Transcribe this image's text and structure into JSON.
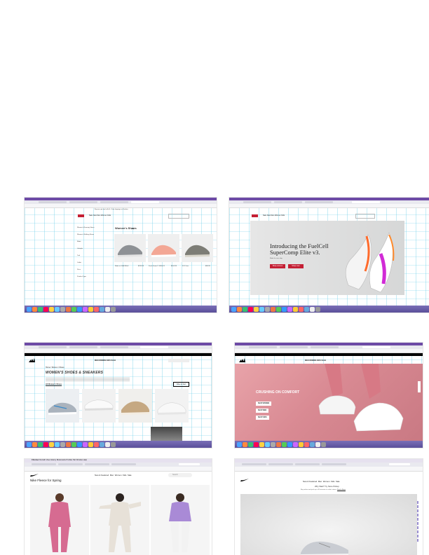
{
  "screens": {
    "nb_list": {
      "promo": "Buy one, get one half off + Free shipping on all orders",
      "title": "Women's Shoes",
      "count": "(73)",
      "sidebar": [
        "Women's Running Shoes",
        "Women's Walking Shoes",
        "Made",
        "Lifestyle",
        "Trail",
        "Outlet",
        "Price",
        "Product Type"
      ],
      "products": [
        {
          "name": "Made in USA 990v6",
          "price": "$199.99"
        },
        {
          "name": "Fresh Foam X 1080v13",
          "price": "$164.99"
        },
        {
          "name": "574 Core",
          "price": "$89.99"
        }
      ]
    },
    "nb_hero": {
      "headline_line1": "Introducing the FuelCell",
      "headline_line2": "SuperComp Elite v3.",
      "subtext": "Made for race day.",
      "button1": "Shop women",
      "button2": "Shop men"
    },
    "adidas_list": {
      "title": "WOMEN'S SHOES & SNEAKERS",
      "tab": "All Women's Shoes",
      "filter": "Filter & Sort",
      "breadcrumb": [
        "Home",
        "Women",
        "Shoes"
      ]
    },
    "adidas_hero": {
      "headline": "CRUSHING ON COMFORT",
      "buttons": [
        "SHOP WOMEN",
        "SHOP MEN",
        "SHOP KIDS"
      ]
    },
    "nike_list": {
      "title": "Nike Fleece for Spring",
      "menu": [
        "New & Featured",
        "Men",
        "Women",
        "Kids",
        "Sale"
      ],
      "search": "Search",
      "os_menu": [
        "Chrome",
        "File",
        "Edit",
        "View",
        "History",
        "Bookmarks",
        "Profiles",
        "Tab",
        "Window",
        "Help"
      ]
    },
    "nike_hero": {
      "menu": [
        "New & Featured",
        "Men",
        "Women",
        "Kids",
        "Sale"
      ],
      "promo_title": "Why Wait? Try Store Pickup",
      "promo_sub": "Buy online and pick up in 30 minutes in select stores.",
      "link": "Find a Store"
    }
  },
  "colors": {
    "nb_red": "#c41f34",
    "adidas_pink": "#d98a93",
    "nike_pink": "#d66b91",
    "nike_lilac": "#a98ad6"
  }
}
